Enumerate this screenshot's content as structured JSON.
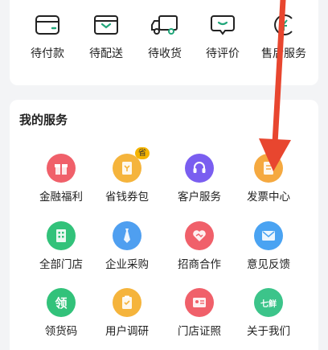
{
  "orders": {
    "items": [
      {
        "label": "待付款",
        "icon": "wallet-icon"
      },
      {
        "label": "待配送",
        "icon": "box-icon"
      },
      {
        "label": "待收货",
        "icon": "truck-icon"
      },
      {
        "label": "待评价",
        "icon": "comment-icon"
      },
      {
        "label": "售后服务",
        "icon": "yen-service-icon"
      }
    ]
  },
  "services": {
    "title": "我的服务",
    "items": [
      {
        "label": "金融福利",
        "icon": "gift-icon",
        "color": "#f0606a"
      },
      {
        "label": "省钱券包",
        "icon": "coupon-icon",
        "color": "#f5b43c",
        "badge": "省"
      },
      {
        "label": "客户服务",
        "icon": "headset-icon",
        "color": "#7a5ef0"
      },
      {
        "label": "发票中心",
        "icon": "invoice-icon",
        "color": "#f5a940"
      },
      {
        "label": "全部门店",
        "icon": "building-icon",
        "color": "#32c27a"
      },
      {
        "label": "企业采购",
        "icon": "tie-icon",
        "color": "#4f9ff0"
      },
      {
        "label": "招商合作",
        "icon": "heart-handshake-icon",
        "color": "#f0606a"
      },
      {
        "label": "意见反馈",
        "icon": "mail-icon",
        "color": "#4aa3f2"
      },
      {
        "label": "领货码",
        "icon": "ling-icon",
        "color": "#32c27a",
        "glyph": "领"
      },
      {
        "label": "用户调研",
        "icon": "survey-icon",
        "color": "#f5b43c"
      },
      {
        "label": "门店证照",
        "icon": "license-icon",
        "color": "#f0606a"
      },
      {
        "label": "关于我们",
        "icon": "qixian-icon",
        "color": "#3cc48a",
        "glyph": "七鲜"
      }
    ]
  },
  "accent": "#e8462f"
}
